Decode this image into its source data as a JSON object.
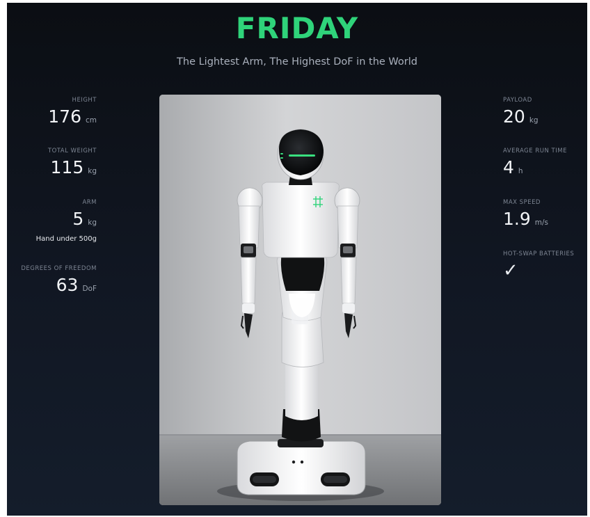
{
  "product": {
    "title": "FRIDAY",
    "tagline": "The Lightest Arm, The Highest DoF in the World"
  },
  "left_stats": [
    {
      "label": "HEIGHT",
      "value": "176",
      "unit": "cm"
    },
    {
      "label": "TOTAL WEIGHT",
      "value": "115",
      "unit": "kg"
    },
    {
      "label": "ARM",
      "value": "5",
      "unit": "kg",
      "note": "Hand under 500g"
    },
    {
      "label": "DEGREES OF FREEDOM",
      "value": "63",
      "unit": "DoF"
    }
  ],
  "right_stats": [
    {
      "label": "PAYLOAD",
      "value": "20",
      "unit": "kg"
    },
    {
      "label": "AVERAGE RUN TIME",
      "value": "4",
      "unit": "h"
    },
    {
      "label": "MAX SPEED",
      "value": "1.9",
      "unit": "m/s"
    },
    {
      "label": "HOT-SWAP BATTERIES",
      "value": "✓"
    }
  ],
  "image": {
    "subject": "robot-photo",
    "colors": {
      "accent": "#2fd37a",
      "background": "#0f141d"
    }
  }
}
